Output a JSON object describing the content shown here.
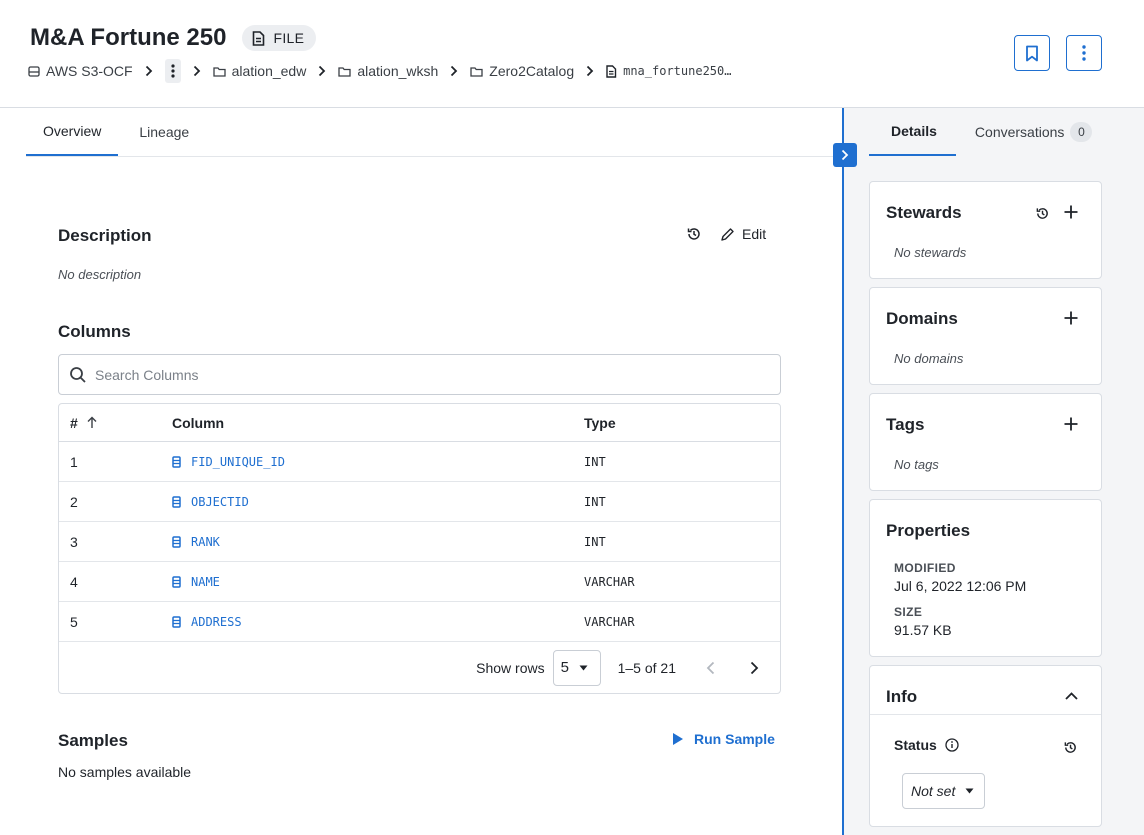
{
  "header": {
    "title": "M&A Fortune 250",
    "type_badge": "FILE",
    "breadcrumb": {
      "source": "AWS S3-OCF",
      "items": [
        "alation_edw",
        "alation_wksh",
        "Zero2Catalog"
      ],
      "current": "mna_fortune250…"
    },
    "icons": {
      "bookmark": "bookmark-icon",
      "more": "more-vertical-icon"
    }
  },
  "tabs": {
    "overview": "Overview",
    "lineage": "Lineage"
  },
  "description": {
    "heading": "Description",
    "edit_label": "Edit",
    "empty_text": "No description"
  },
  "columns": {
    "heading": "Columns",
    "search_placeholder": "Search Columns",
    "headers": {
      "num": "#",
      "column": "Column",
      "type": "Type"
    },
    "rows": [
      {
        "num": "1",
        "name": "FID_UNIQUE_ID",
        "type": "INT"
      },
      {
        "num": "2",
        "name": "OBJECTID",
        "type": "INT"
      },
      {
        "num": "3",
        "name": "RANK",
        "type": "INT"
      },
      {
        "num": "4",
        "name": "NAME",
        "type": "VARCHAR"
      },
      {
        "num": "5",
        "name": "ADDRESS",
        "type": "VARCHAR"
      }
    ],
    "pagination": {
      "show_rows_label": "Show rows",
      "rows_per_page": "5",
      "range": "1–5 of 21"
    }
  },
  "samples": {
    "heading": "Samples",
    "run_label": "Run Sample",
    "empty_text": "No samples available"
  },
  "right_panel": {
    "tabs": {
      "details": "Details",
      "conversations": "Conversations",
      "conversations_count": "0"
    },
    "stewards": {
      "title": "Stewards",
      "empty": "No stewards"
    },
    "domains": {
      "title": "Domains",
      "empty": "No domains"
    },
    "tags": {
      "title": "Tags",
      "empty": "No tags"
    },
    "properties": {
      "title": "Properties",
      "modified_label": "MODIFIED",
      "modified_value": "Jul 6, 2022 12:06 PM",
      "size_label": "SIZE",
      "size_value": "91.57 KB"
    },
    "info": {
      "title": "Info",
      "status_label": "Status",
      "status_value": "Not set"
    }
  },
  "colors": {
    "accent": "#1f6fd0",
    "border": "#d9dde3",
    "panel_bg": "#f4f5f7"
  }
}
